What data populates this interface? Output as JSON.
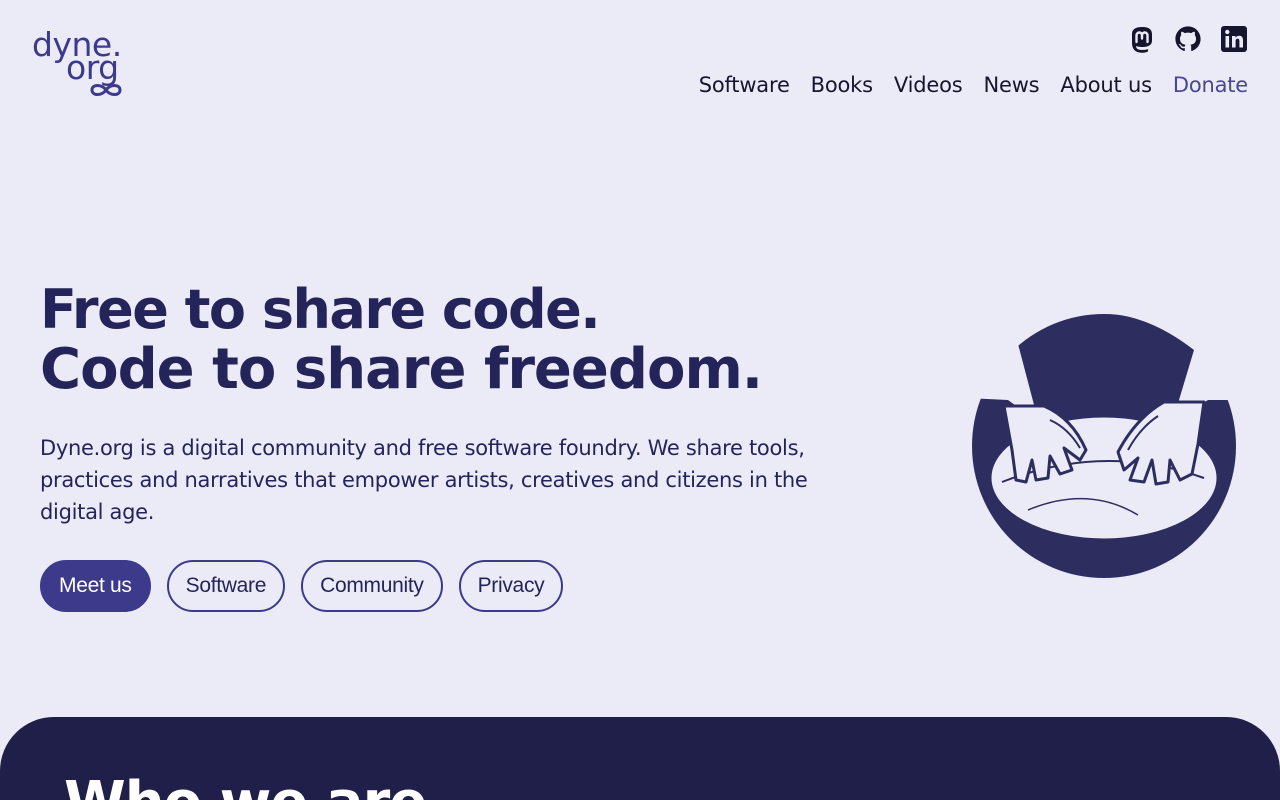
{
  "logo": {
    "line1": "dyne.",
    "line2": "org"
  },
  "social": [
    {
      "name": "mastodon-icon"
    },
    {
      "name": "github-icon"
    },
    {
      "name": "linkedin-icon"
    }
  ],
  "nav": {
    "items": [
      "Software",
      "Books",
      "Videos",
      "News",
      "About us"
    ],
    "donate": "Donate"
  },
  "hero": {
    "title_line1": "Free to share code.",
    "title_line2": "Code to share freedom.",
    "description": "Dyne.org is a digital community and free software foundry. We share tools, practices and narratives that empower artists, creatives and citizens in the digital age.",
    "buttons": [
      "Meet us",
      "Software",
      "Community",
      "Privacy"
    ]
  },
  "section": {
    "heading": "Who we are"
  },
  "colors": {
    "background": "#ebebf7",
    "accent": "#3d3a8c",
    "dark": "#201f4a",
    "text": "#25245a"
  }
}
